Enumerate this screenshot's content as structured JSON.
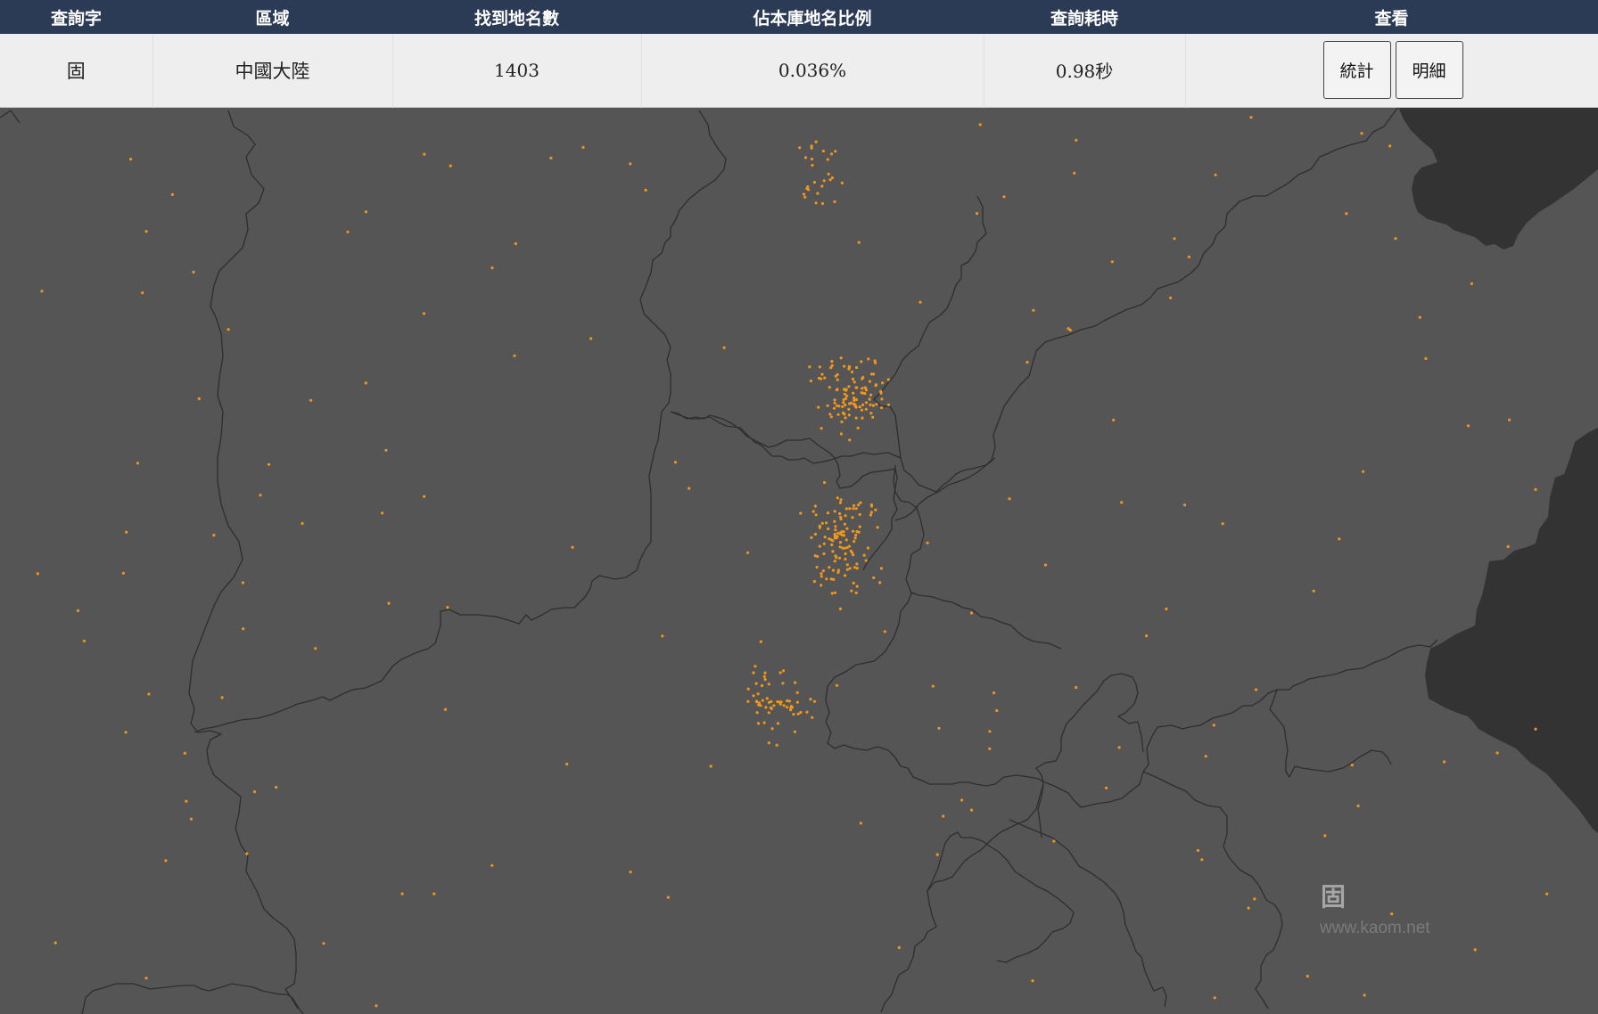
{
  "table": {
    "headers": [
      "查詢字",
      "區域",
      "找到地名數",
      "佔本庫地名比例",
      "查詢耗時",
      "查看"
    ],
    "row": {
      "query_char": "固",
      "region": "中國大陸",
      "count": "1403",
      "ratio": "0.036%",
      "time": "0.98秒"
    },
    "buttons": {
      "stats": "統計",
      "detail": "明細"
    }
  },
  "map": {
    "land_color": "#555555",
    "sea_color": "#333333",
    "border_color": "#2e2e2e",
    "dot_color": "#f0961e"
  },
  "watermark": {
    "glyph": "固",
    "site": "www.kaom.net"
  }
}
